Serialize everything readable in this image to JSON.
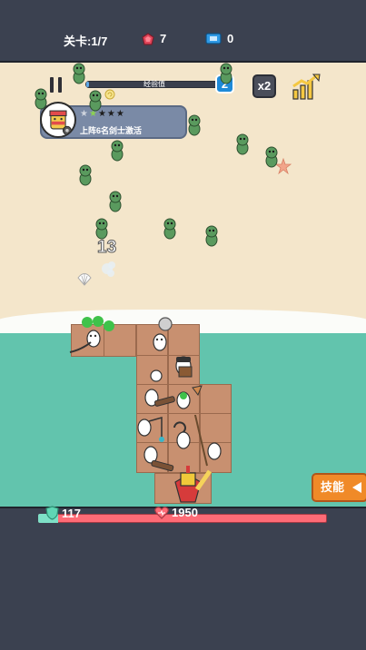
{
  "topbar": {
    "level_text": "关卡:1/7",
    "gems": "7",
    "tickets": "0"
  },
  "hud": {
    "xp_label": "经验值",
    "xp_progress": 0.02,
    "player_level": "2",
    "speed_label": "x2"
  },
  "quest": {
    "stars_earned": 2,
    "stars_total": 5,
    "text": "上阵6名剑士激活"
  },
  "battle": {
    "damage_number": "13"
  },
  "skill_button": {
    "label": "技能"
  },
  "status": {
    "shield_value": "117",
    "hp_value": "1950"
  },
  "colors": {
    "topbar": "#3b4150",
    "sand": "#f4e6cb",
    "sea": "#62c4ad",
    "raft": "#c89070",
    "hp": "#fe6b76",
    "skill": "#f08a28",
    "zombie": "#5a9a5e"
  }
}
